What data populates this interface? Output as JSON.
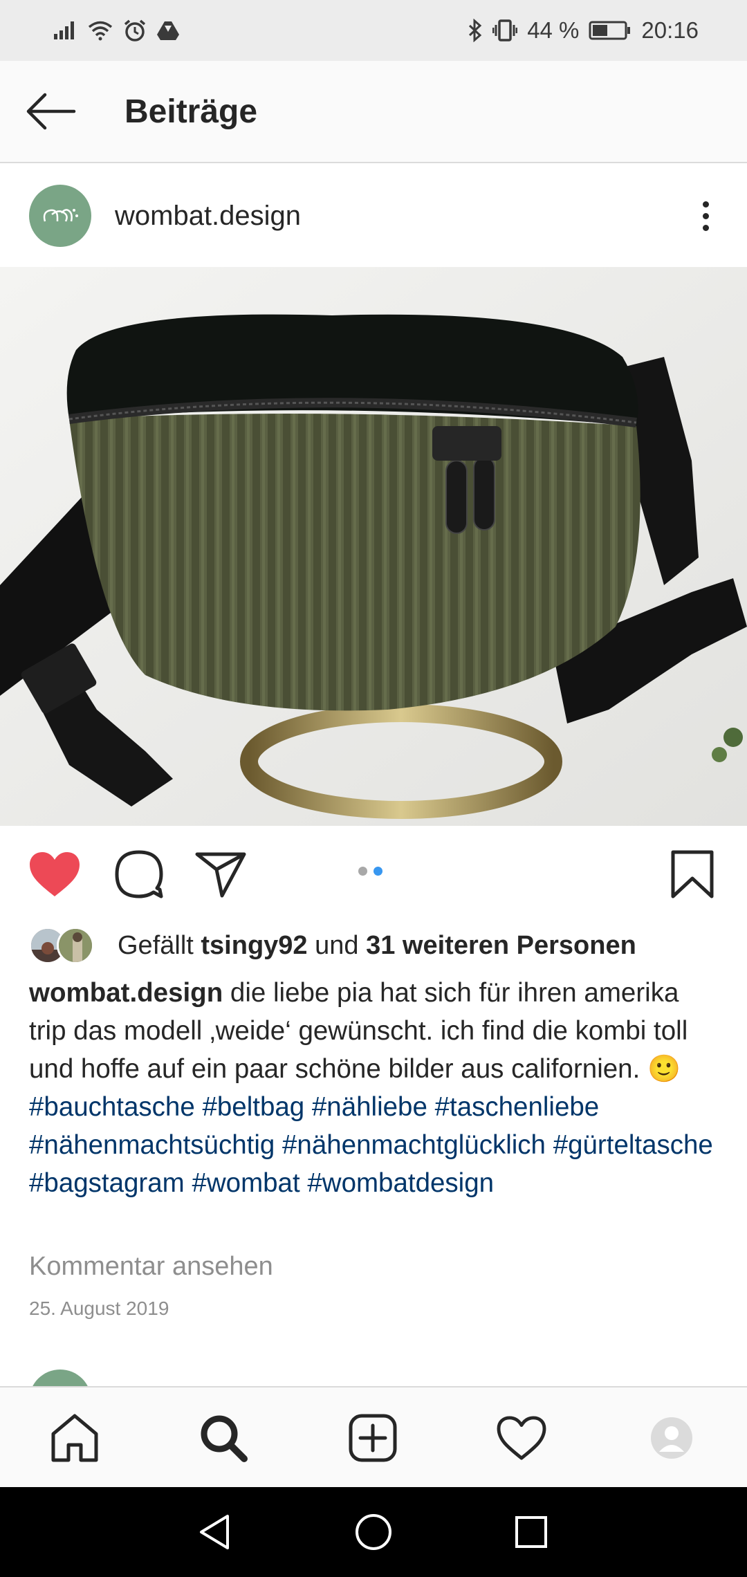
{
  "status_bar": {
    "battery_percent": "44 %",
    "time": "20:16",
    "icons_left": [
      "signal-icon",
      "wifi-icon",
      "alarm-icon",
      "drive-icon"
    ],
    "icons_right": [
      "bluetooth-icon",
      "vibrate-icon",
      "battery-icon"
    ]
  },
  "header": {
    "title": "Beiträge"
  },
  "post": {
    "username": "wombat.design",
    "image": "photo of an olive green corduroy belt bag with black velvet top and black strap",
    "carousel": {
      "count": 2,
      "active": 2,
      "active_color": "#3897f0",
      "inactive_color": "#a8a8a8"
    },
    "liked": true,
    "like_color": "#ed4956",
    "likes": {
      "prefix": "Gefällt",
      "user": "tsingy92",
      "connector": "und",
      "others": "31 weiteren Personen"
    },
    "caption": {
      "author": "wombat.design",
      "text": "die liebe pia hat sich für ihren amerika trip das modell ‚weide‘ gewünscht. ich find die kombi toll und hoffe auf ein paar schöne bilder aus californien. 🙂 ",
      "hashtags": [
        "#bauchtasche",
        "#beltbag",
        "#nähliebe",
        "#taschenliebe",
        "#nähenmachtsüchtig",
        "#nähenmachtglücklich",
        "#gürteltasche",
        "#bagstagram",
        "#wombat",
        "#wombatdesign"
      ],
      "hashtag_color": "#003569"
    },
    "view_comments": "Kommentar ansehen",
    "date": "25. August 2019"
  },
  "bottom_nav": {
    "items": [
      "home-icon",
      "search-icon",
      "new-post-icon",
      "activity-heart-icon",
      "profile-avatar-icon"
    ],
    "active": "search-icon"
  },
  "system_nav": {
    "items": [
      "back-triangle-icon",
      "home-circle-icon",
      "recents-square-icon"
    ]
  }
}
